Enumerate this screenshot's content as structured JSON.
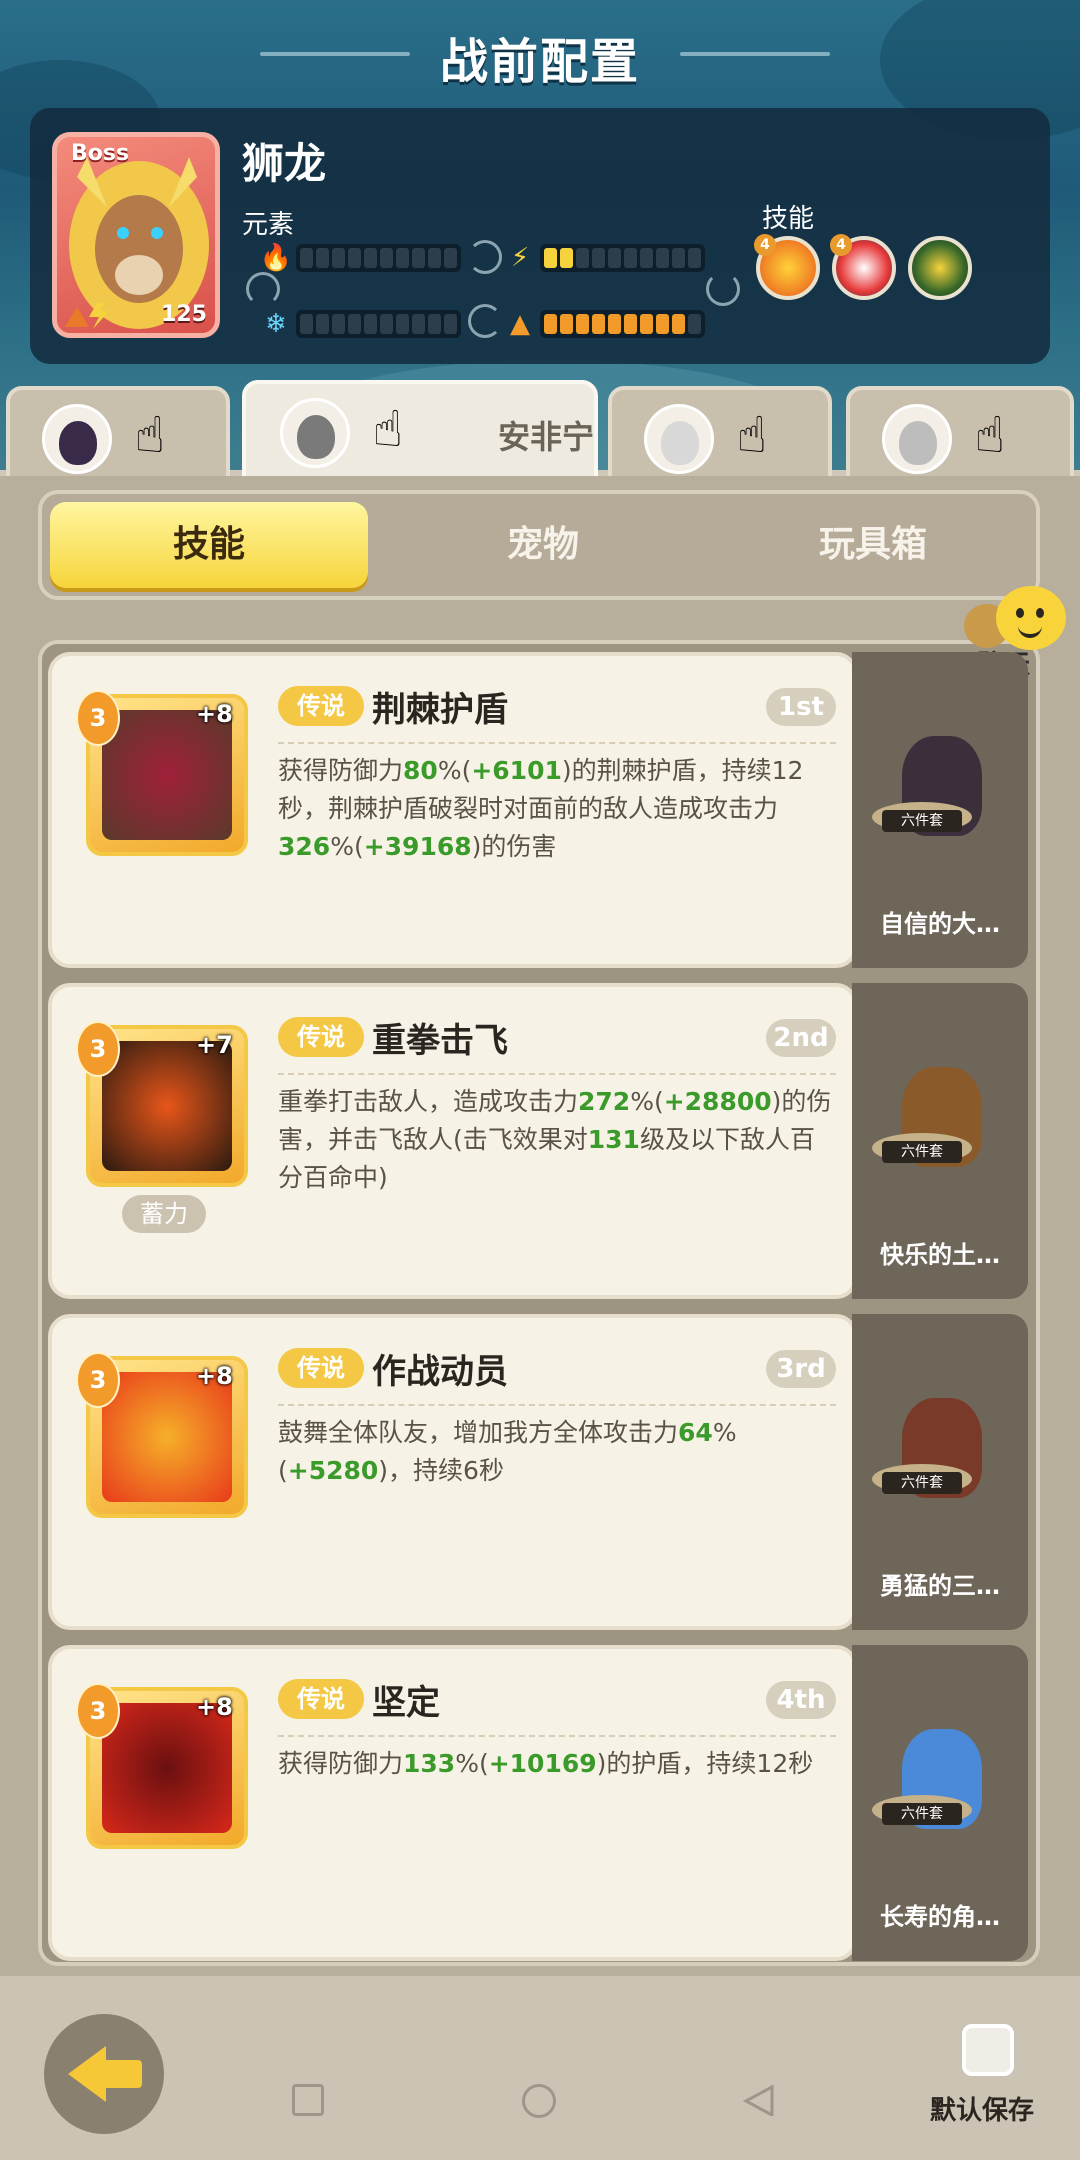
{
  "header": {
    "title": "战前配置"
  },
  "boss": {
    "tag": "Boss",
    "name": "狮龙",
    "level": "125",
    "element_label": "元素",
    "skill_label": "技能",
    "skill_levels": [
      "4",
      "4"
    ],
    "elements": [
      {
        "icon": "fire-icon",
        "level": 0
      },
      {
        "icon": "lightning-icon",
        "level": 2
      },
      {
        "icon": "ice-icon",
        "level": 0
      },
      {
        "icon": "earth-icon",
        "level": 9
      }
    ]
  },
  "heroes": [
    {
      "name": "",
      "icon": "hero-avatar"
    },
    {
      "name": "安非宁",
      "icon": "hero-avatar"
    },
    {
      "name": "",
      "icon": "hero-avatar"
    },
    {
      "name": "",
      "icon": "hero-avatar"
    }
  ],
  "sub_tabs": [
    "技能",
    "宠物",
    "玩具箱"
  ],
  "chat": {
    "label": "聊天"
  },
  "skills": [
    {
      "rank": "3",
      "plus": "+8",
      "legend": "传说",
      "title": "荆棘护盾",
      "order": "1st",
      "charge": "",
      "desc": [
        {
          "t": "获得防御力"
        },
        {
          "t": "80",
          "g": true
        },
        {
          "t": "%("
        },
        {
          "t": "+6101",
          "g": true
        },
        {
          "t": ")的荆棘护盾，持续12秒，荆棘护盾破裂时对面前的敌人造成攻击力"
        },
        {
          "t": "326",
          "g": true
        },
        {
          "t": "%("
        },
        {
          "t": "+39168",
          "g": true
        },
        {
          "t": ")的伤害"
        }
      ],
      "pet": {
        "name": "自信的大…",
        "set": "六件套"
      }
    },
    {
      "rank": "3",
      "plus": "+7",
      "legend": "传说",
      "title": "重拳击飞",
      "order": "2nd",
      "charge": "蓄力",
      "desc": [
        {
          "t": "重拳打击敌人，造成攻击力"
        },
        {
          "t": "272",
          "g": true
        },
        {
          "t": "%("
        },
        {
          "t": "+28800",
          "g": true
        },
        {
          "t": ")的伤害，并击飞敌人(击飞效果对"
        },
        {
          "t": "131",
          "g": true
        },
        {
          "t": "级及以下敌人百分百命中)"
        }
      ],
      "pet": {
        "name": "快乐的土…",
        "set": "六件套"
      }
    },
    {
      "rank": "3",
      "plus": "+8",
      "legend": "传说",
      "title": "作战动员",
      "order": "3rd",
      "charge": "",
      "desc": [
        {
          "t": "鼓舞全体队友，增加我方全体攻击力"
        },
        {
          "t": "64",
          "g": true
        },
        {
          "t": "%("
        },
        {
          "t": "+5280",
          "g": true
        },
        {
          "t": ")，持续6秒"
        }
      ],
      "pet": {
        "name": "勇猛的三…",
        "set": "六件套"
      }
    },
    {
      "rank": "3",
      "plus": "+8",
      "legend": "传说",
      "title": "坚定",
      "order": "4th",
      "charge": "",
      "desc": [
        {
          "t": "获得防御力"
        },
        {
          "t": "133",
          "g": true
        },
        {
          "t": "%("
        },
        {
          "t": "+10169",
          "g": true
        },
        {
          "t": ")的护盾，持续12秒"
        }
      ],
      "pet": {
        "name": "长寿的角…",
        "set": "六件套"
      }
    }
  ],
  "footer": {
    "save_label": "默认保存"
  }
}
